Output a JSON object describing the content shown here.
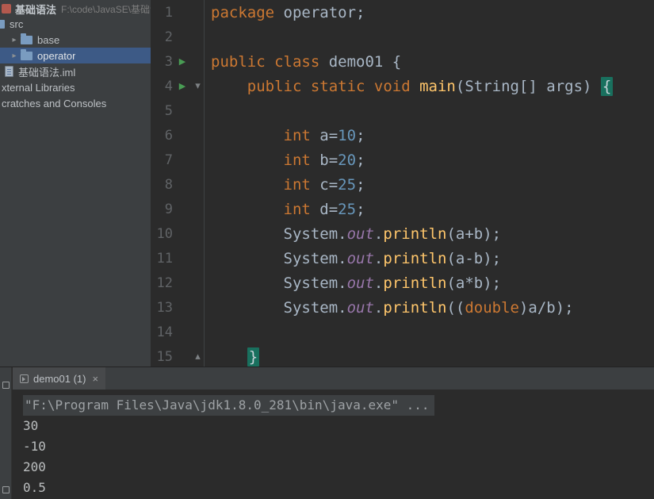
{
  "colors": {
    "editor_bg": "#2b2b2b",
    "panel_bg": "#3c3f41",
    "selection_blue": "#3d5a86",
    "keyword": "#cc7832",
    "number": "#6897bb",
    "method": "#ffc66b",
    "field_italic": "#9876aa",
    "plain_text": "#a9b7c6",
    "line_number": "#606366",
    "brace_highlight_bg": "#19705e",
    "run_green": "#499c54"
  },
  "icons": {
    "run": "▶",
    "fold_top": "▾",
    "fold_bottom": "▴",
    "chevron_collapsed": "▸",
    "close": "×"
  },
  "project_panel": {
    "title": {
      "name": "基础语法",
      "path": "F:\\code\\JavaSE\\基础语法"
    },
    "items": [
      {
        "label": "src",
        "icon": "folder",
        "style": "cut",
        "selected": false
      },
      {
        "label": "base",
        "icon": "folder",
        "chevron": true,
        "style": "child",
        "selected": false
      },
      {
        "label": "operator",
        "icon": "folder",
        "chevron": true,
        "style": "child",
        "selected": true
      },
      {
        "label": "基础语法.iml",
        "icon": "file",
        "style": "root",
        "selected": false
      },
      {
        "label": "xternal Libraries",
        "icon": "none",
        "style": "edge",
        "selected": false
      },
      {
        "label": "cratches and Consoles",
        "icon": "none",
        "style": "edge",
        "selected": false
      }
    ]
  },
  "editor": {
    "lines": [
      {
        "num": "1",
        "code": [
          [
            "kw",
            "package"
          ],
          [
            "pln",
            " operator;"
          ]
        ]
      },
      {
        "num": "2",
        "code": []
      },
      {
        "num": "3",
        "run": true,
        "code": [
          [
            "kw",
            "public class"
          ],
          [
            "pln",
            " demo01 {"
          ]
        ]
      },
      {
        "num": "4",
        "run": true,
        "fold": "top",
        "code": [
          [
            "pln",
            "    "
          ],
          [
            "kw",
            "public static void"
          ],
          [
            "mth",
            " main"
          ],
          [
            "pln",
            "(String[] args) "
          ],
          [
            "brc",
            "{"
          ]
        ]
      },
      {
        "num": "5",
        "code": []
      },
      {
        "num": "6",
        "code": [
          [
            "pln",
            "        "
          ],
          [
            "kw",
            "int"
          ],
          [
            "pln",
            " a="
          ],
          [
            "num",
            "10"
          ],
          [
            "pln",
            ";"
          ]
        ]
      },
      {
        "num": "7",
        "code": [
          [
            "pln",
            "        "
          ],
          [
            "kw",
            "int"
          ],
          [
            "pln",
            " b="
          ],
          [
            "num",
            "20"
          ],
          [
            "pln",
            ";"
          ]
        ]
      },
      {
        "num": "8",
        "code": [
          [
            "pln",
            "        "
          ],
          [
            "kw",
            "int"
          ],
          [
            "pln",
            " c="
          ],
          [
            "num",
            "25"
          ],
          [
            "pln",
            ";"
          ]
        ]
      },
      {
        "num": "9",
        "code": [
          [
            "pln",
            "        "
          ],
          [
            "kw",
            "int"
          ],
          [
            "pln",
            " d="
          ],
          [
            "num",
            "25"
          ],
          [
            "pln",
            ";"
          ]
        ]
      },
      {
        "num": "10",
        "code": [
          [
            "pln",
            "        System."
          ],
          [
            "fld",
            "out"
          ],
          [
            "pln",
            "."
          ],
          [
            "mth",
            "println"
          ],
          [
            "pln",
            "(a+b);"
          ]
        ]
      },
      {
        "num": "11",
        "code": [
          [
            "pln",
            "        System."
          ],
          [
            "fld",
            "out"
          ],
          [
            "pln",
            "."
          ],
          [
            "mth",
            "println"
          ],
          [
            "pln",
            "(a-b);"
          ]
        ]
      },
      {
        "num": "12",
        "code": [
          [
            "pln",
            "        System."
          ],
          [
            "fld",
            "out"
          ],
          [
            "pln",
            "."
          ],
          [
            "mth",
            "println"
          ],
          [
            "pln",
            "(a*b);"
          ]
        ]
      },
      {
        "num": "13",
        "code": [
          [
            "pln",
            "        System."
          ],
          [
            "fld",
            "out"
          ],
          [
            "pln",
            "."
          ],
          [
            "mth",
            "println"
          ],
          [
            "pln",
            "(("
          ],
          [
            "kw",
            "double"
          ],
          [
            "pln",
            ")a/b);"
          ]
        ]
      },
      {
        "num": "14",
        "code": []
      },
      {
        "num": "15",
        "fold": "bottom",
        "code": [
          [
            "pln",
            "    "
          ],
          [
            "brc",
            "}"
          ]
        ]
      }
    ]
  },
  "bottom_panel": {
    "tab": {
      "label": "demo01 (1)"
    },
    "console_lines": [
      {
        "text": "\"F:\\Program Files\\Java\\jdk1.8.0_281\\bin\\java.exe\" ...",
        "style": "cmd"
      },
      {
        "text": "30"
      },
      {
        "text": "-10"
      },
      {
        "text": "200"
      },
      {
        "text": "0.5"
      }
    ]
  }
}
